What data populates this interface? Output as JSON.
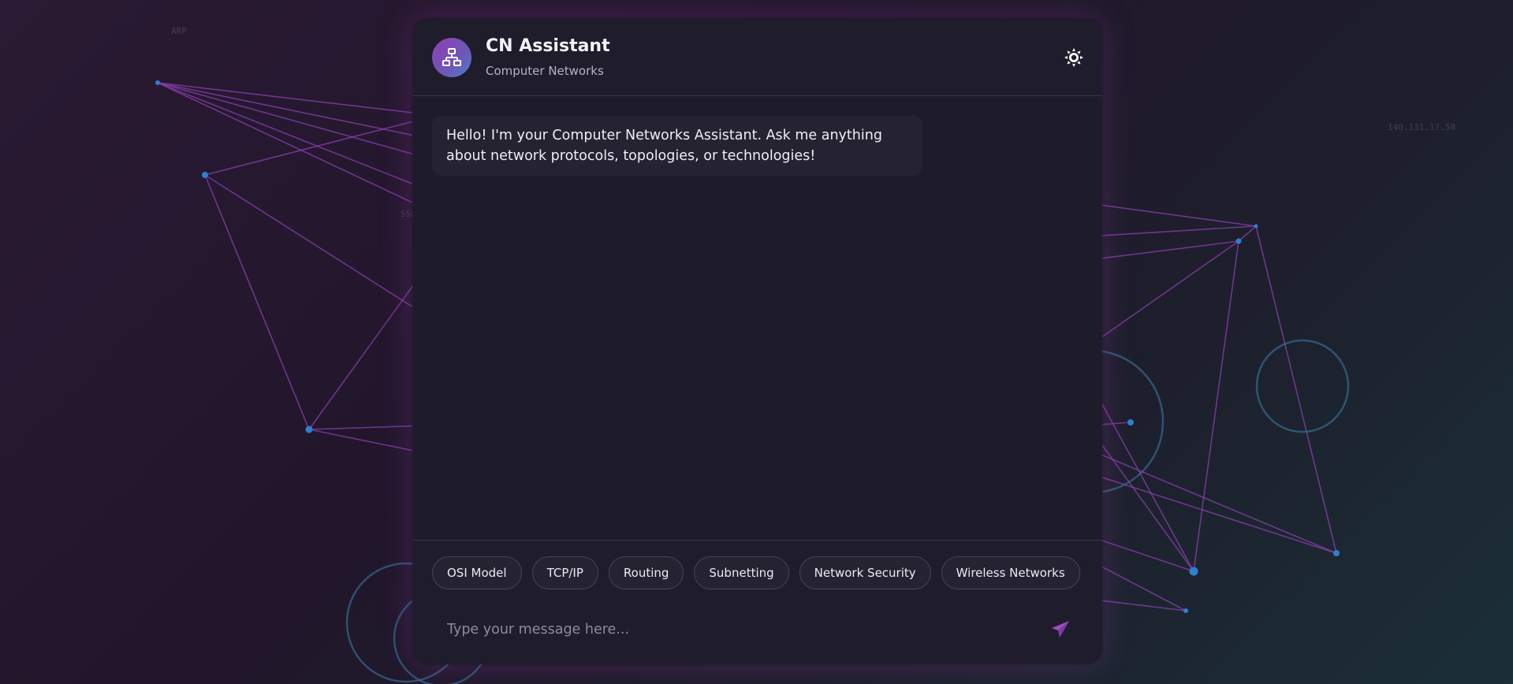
{
  "background": {
    "labels": [
      "ARP",
      "SSH",
      "140.131.17.58"
    ]
  },
  "header": {
    "title": "CN Assistant",
    "subtitle": "Computer Networks",
    "avatar_icon": "network-icon",
    "theme_icon": "sun-icon"
  },
  "messages": [
    {
      "role": "assistant",
      "text": "Hello! I'm your Computer Networks Assistant. Ask me anything about network protocols, topologies, or technologies!"
    }
  ],
  "quick_topics": [
    "OSI Model",
    "TCP/IP",
    "Routing",
    "Subnetting",
    "Network Security",
    "Wireless Networks"
  ],
  "input": {
    "placeholder": "Type your message here...",
    "value": "",
    "send_icon": "paper-plane-icon"
  },
  "colors": {
    "accent": "#8e3fb0",
    "accent_blue": "#4a80c9",
    "panel": "#1f1d2b",
    "line": "#8a3fae"
  }
}
